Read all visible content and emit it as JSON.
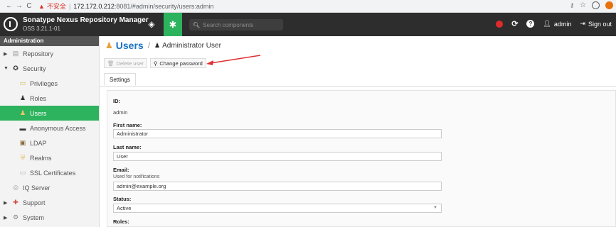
{
  "browser": {
    "nav": {
      "back": "←",
      "forward": "→",
      "reload": "C"
    },
    "insecure_label": "不安全",
    "url_host": "172.172.0.212",
    "url_rest": ":8081/#admin/security/users:admin"
  },
  "header": {
    "title": "Sonatype Nexus Repository Manager",
    "version": "OSS 3.21.1-01",
    "search_placeholder": "Search components",
    "user_label": "admin",
    "signout_label": "Sign out"
  },
  "sidebar": {
    "heading": "Administration",
    "items": [
      {
        "label": "Repository"
      },
      {
        "label": "Security"
      },
      {
        "label": "Privileges"
      },
      {
        "label": "Roles"
      },
      {
        "label": "Users"
      },
      {
        "label": "Anonymous Access"
      },
      {
        "label": "LDAP"
      },
      {
        "label": "Realms"
      },
      {
        "label": "SSL Certificates"
      },
      {
        "label": "IQ Server"
      },
      {
        "label": "Support"
      },
      {
        "label": "System"
      }
    ]
  },
  "main": {
    "title": "Users",
    "subtitle": "Administrator User",
    "delete_label": "Delete user",
    "change_password_label": "Change password",
    "tab_settings": "Settings"
  },
  "form": {
    "id_label": "ID:",
    "id_value": "admin",
    "first_name_label": "First name:",
    "first_name_value": "Administrator",
    "last_name_label": "Last name:",
    "last_name_value": "User",
    "email_label": "Email:",
    "email_help": "Used for notifications",
    "email_value": "admin@example.org",
    "status_label": "Status:",
    "status_value": "Active",
    "roles_label": "Roles:"
  },
  "colors": {
    "accent": "#2db35d",
    "header": "#2d2d2d",
    "title_blue": "#1a73c5",
    "arrow_red": "#e03030"
  }
}
